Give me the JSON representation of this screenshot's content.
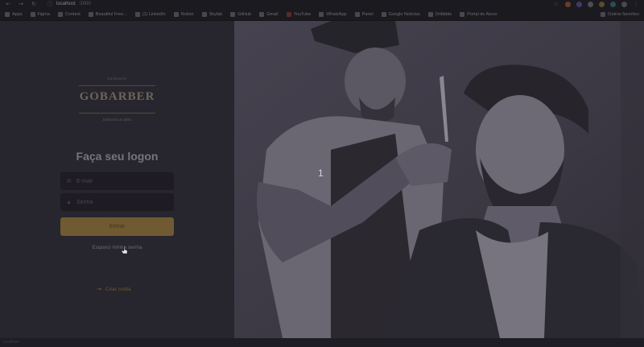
{
  "browser": {
    "url_host": "localhost",
    "url_port": ":3000",
    "bookmarks": [
      {
        "label": "Apps",
        "icon": "apps-grid-icon"
      },
      {
        "label": "Figma",
        "icon": "figma-icon"
      },
      {
        "label": "Context",
        "icon": "context-icon"
      },
      {
        "label": "Beautiful Free...",
        "icon": "unsplash-icon"
      },
      {
        "label": "(1) LinkedIn",
        "icon": "linkedin-icon"
      },
      {
        "label": "Notion",
        "icon": "notion-icon"
      },
      {
        "label": "Skylab",
        "icon": "skylab-icon"
      },
      {
        "label": "GitHub",
        "icon": "github-icon"
      },
      {
        "label": "Gmail",
        "icon": "gmail-icon"
      },
      {
        "label": "YouTube",
        "icon": "youtube-icon"
      },
      {
        "label": "WhatsApp",
        "icon": "whatsapp-icon"
      },
      {
        "label": "Panel",
        "icon": "panel-icon"
      },
      {
        "label": "Google Notícias",
        "icon": "google-news-icon"
      },
      {
        "label": "Dribbble",
        "icon": "dribbble-icon"
      },
      {
        "label": "Portal do Aluno",
        "icon": "folder-icon"
      }
    ],
    "other_bookmarks": "Outros favoritos"
  },
  "brand": {
    "top_text": "barbearia",
    "name": "GOBARBER",
    "tagline": "barbearia & salão"
  },
  "form": {
    "title": "Faça seu logon",
    "email_placeholder": "E-mail",
    "password_placeholder": "Senha",
    "submit_label": "Entrar",
    "forgot_label": "Esqueci minha senha",
    "create_account_label": "Criar conta"
  },
  "overlay": {
    "counter": "1"
  },
  "colors": {
    "background": "#232129",
    "accent": "#6f5a32",
    "input_bg": "#1e1c22"
  }
}
